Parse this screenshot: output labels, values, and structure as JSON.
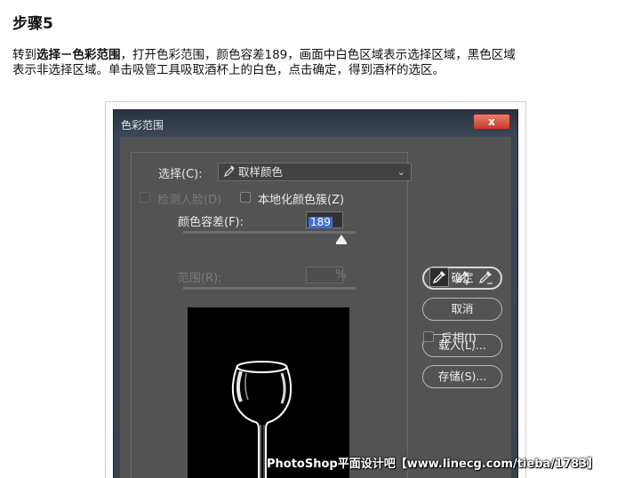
{
  "article": {
    "step_title": "步骤5",
    "instruction_prefix": "转到",
    "instruction_bold": "选择－色彩范围",
    "instruction_line1_rest": "，打开色彩范围，颜色容差189，画面中白色区域表示选择区域，黑色区域",
    "instruction_line2": "表示非选择区域。单击吸管工具吸取酒杯上的白色，点击确定，得到酒杯的选区。"
  },
  "dialog": {
    "title": "色彩范围",
    "close_label": "x",
    "select_label": "选择(C):",
    "select_value": "取样颜色",
    "detect_faces_label": "检测人脸(D)",
    "localized_clusters_label": "本地化颜色簇(Z)",
    "fuzziness_label": "颜色容差(F):",
    "fuzziness_value": "189",
    "fuzziness_fraction": 0.92,
    "range_label": "范围(R):",
    "range_unit": "%",
    "invert_label": "反相(I)"
  },
  "buttons": {
    "ok": "确定",
    "cancel": "取消",
    "load": "载入(L)...",
    "save": "存储(S)..."
  },
  "icons": {
    "select_icon": "eyedropper-icon",
    "tools": [
      "eyedropper-icon",
      "eyedropper-plus-icon",
      "eyedropper-minus-icon"
    ]
  },
  "watermark": "PhotoShop平面设计吧【www.linecg.com/tieba/1783】"
}
